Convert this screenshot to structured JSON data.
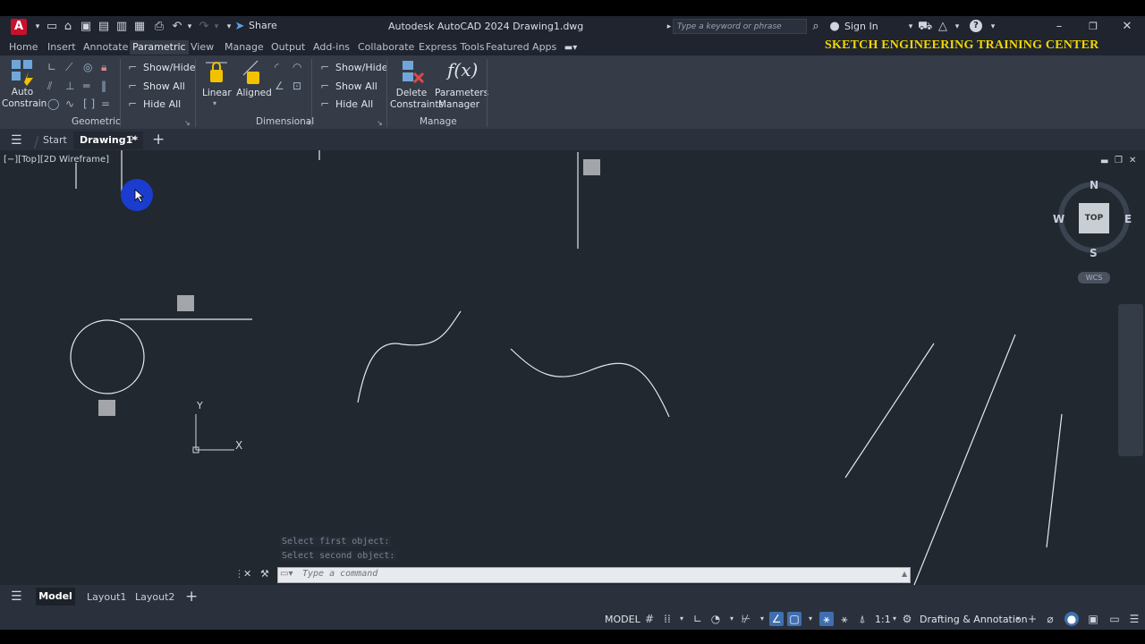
{
  "titlebar": {
    "app_letter": "A",
    "share_label": "Share",
    "title": "Autodesk AutoCAD 2024   Drawing1.dwg",
    "search_placeholder": "Type a keyword or phrase",
    "signin_label": "Sign In"
  },
  "menu": {
    "tabs": [
      "Home",
      "Insert",
      "Annotate",
      "Parametric",
      "View",
      "Manage",
      "Output",
      "Add-ins",
      "Collaborate",
      "Express Tools",
      "Featured Apps"
    ],
    "active_tab": "Parametric",
    "brand_text": "SKETCH ENGINEERING TRAINING CENTER"
  },
  "ribbon": {
    "auto_constrain": "Auto\nConstrain",
    "auto_constrain_l1": "Auto",
    "auto_constrain_l2": "Constrain",
    "geom_show_hide": "Show/Hide",
    "geom_show_all": "Show All",
    "geom_hide_all": "Hide All",
    "geometric_title": "Geometric",
    "linear": "Linear",
    "aligned": "Aligned",
    "dim_show_hide": "Show/Hide",
    "dim_show_all": "Show All",
    "dim_hide_all": "Hide All",
    "dimensional_title": "Dimensional",
    "delete_l1": "Delete",
    "delete_l2": "Constraints",
    "params_l1": "Parameters",
    "params_l2": "Manager",
    "manage_title": "Manage"
  },
  "filetabs": {
    "start": "Start",
    "drawing": "Drawing1*"
  },
  "viewport": {
    "label": "[−][Top][2D Wireframe]",
    "history": [
      "Select first object:",
      "Select second object:"
    ],
    "command_placeholder": "Type a command",
    "ucs_x": "X",
    "ucs_y": "Y"
  },
  "viewcube": {
    "n": "N",
    "s": "S",
    "e": "E",
    "w": "W",
    "top": "TOP",
    "wcs": "WCS"
  },
  "layouts": [
    "Model",
    "Layout1",
    "Layout2"
  ],
  "status": {
    "model": "MODEL",
    "scale": "1:1",
    "workspace": "Drafting & Annotation"
  }
}
